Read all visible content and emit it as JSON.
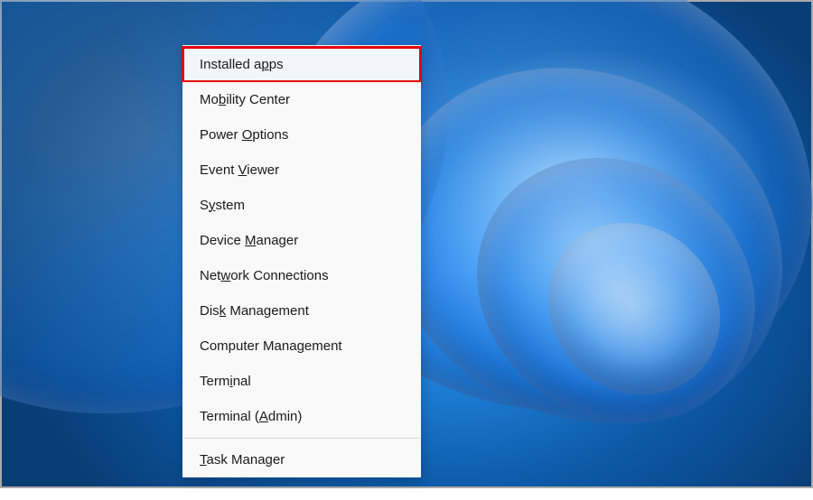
{
  "context_menu": {
    "items": [
      {
        "pre": "Installed a",
        "u": "p",
        "post": "ps",
        "highlighted": true
      },
      {
        "pre": "Mo",
        "u": "b",
        "post": "ility Center"
      },
      {
        "pre": "Power ",
        "u": "O",
        "post": "ptions"
      },
      {
        "pre": "Event ",
        "u": "V",
        "post": "iewer"
      },
      {
        "pre": "S",
        "u": "y",
        "post": "stem"
      },
      {
        "pre": "Device ",
        "u": "M",
        "post": "anager"
      },
      {
        "pre": "Net",
        "u": "w",
        "post": "ork Connections"
      },
      {
        "pre": "Dis",
        "u": "k",
        "post": " Management"
      },
      {
        "pre": "Computer Mana",
        "u": "g",
        "post": "ement"
      },
      {
        "pre": "Term",
        "u": "i",
        "post": "nal"
      },
      {
        "pre": "Terminal (",
        "u": "A",
        "post": "dmin)"
      }
    ],
    "after_divider": [
      {
        "pre": "",
        "u": "T",
        "post": "ask Manager"
      }
    ]
  }
}
